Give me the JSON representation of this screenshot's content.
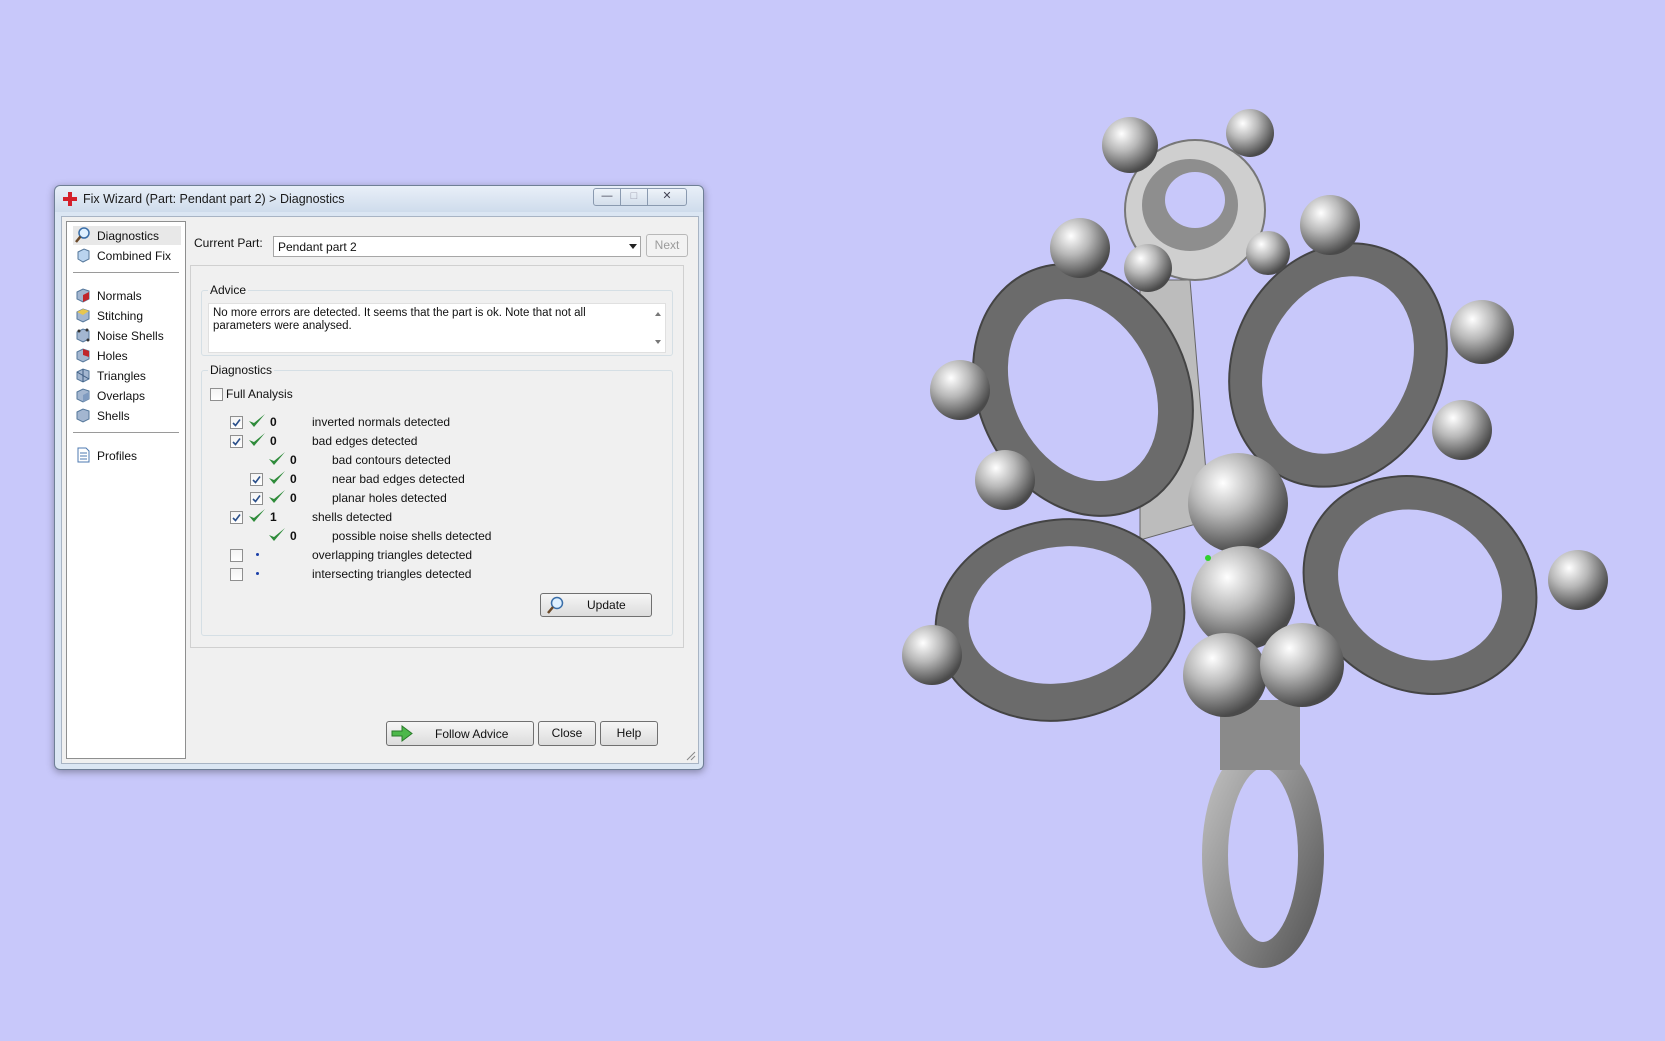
{
  "window": {
    "title": "Fix Wizard (Part: Pendant part 2) > Diagnostics",
    "buttons": {
      "minimize": "—",
      "maximize": "□",
      "close": "✕"
    }
  },
  "sidebar": {
    "items": [
      {
        "label": "Diagnostics",
        "icon": "magnifier-icon",
        "selected": true
      },
      {
        "label": "Combined Fix",
        "icon": "cube-icon"
      },
      {
        "label": "Normals",
        "icon": "cube-red-icon"
      },
      {
        "label": "Stitching",
        "icon": "cube-yellow-icon"
      },
      {
        "label": "Noise Shells",
        "icon": "cube-dots-icon"
      },
      {
        "label": "Holes",
        "icon": "cube-red-icon"
      },
      {
        "label": "Triangles",
        "icon": "cube-icon"
      },
      {
        "label": "Overlaps",
        "icon": "cube-icon"
      },
      {
        "label": "Shells",
        "icon": "cube-icon"
      },
      {
        "label": "Profiles",
        "icon": "document-icon"
      }
    ]
  },
  "current_part": {
    "label": "Current Part:",
    "value": "Pendant part 2"
  },
  "next_label": "Next",
  "advice": {
    "title": "Advice",
    "text": "No more errors are detected. It seems that the part is ok. Note that not all parameters were analysed."
  },
  "diagnostics": {
    "title": "Diagnostics",
    "full_analysis_label": "Full Analysis",
    "rows": [
      {
        "checked": true,
        "status": "ok",
        "count": "0",
        "label": "inverted normals detected",
        "indent": 0
      },
      {
        "checked": true,
        "status": "ok",
        "count": "0",
        "label": "bad edges detected",
        "indent": 0
      },
      {
        "checkbox": false,
        "status": "ok",
        "count": "0",
        "label": "bad contours detected",
        "indent": 1
      },
      {
        "checked": true,
        "status": "ok",
        "count": "0",
        "label": "near bad edges detected",
        "indent": 1
      },
      {
        "checked": true,
        "status": "ok",
        "count": "0",
        "label": "planar holes detected",
        "indent": 1
      },
      {
        "checked": true,
        "status": "ok",
        "count": "1",
        "label": "shells detected",
        "indent": 0
      },
      {
        "checkbox": false,
        "status": "ok",
        "count": "0",
        "label": "possible noise shells detected",
        "indent": 1
      },
      {
        "checked": false,
        "status": "pending",
        "count": "",
        "label": "overlapping triangles detected",
        "indent": 0
      },
      {
        "checked": false,
        "status": "pending",
        "count": "",
        "label": "intersecting triangles detected",
        "indent": 0
      }
    ],
    "update_label": "Update"
  },
  "footer": {
    "follow_advice_label": "Follow Advice",
    "close_label": "Close",
    "help_label": "Help"
  },
  "colors": {
    "background": "#c8c8fa",
    "tick": "#2e8b3a",
    "model": "#8a8a8a"
  }
}
